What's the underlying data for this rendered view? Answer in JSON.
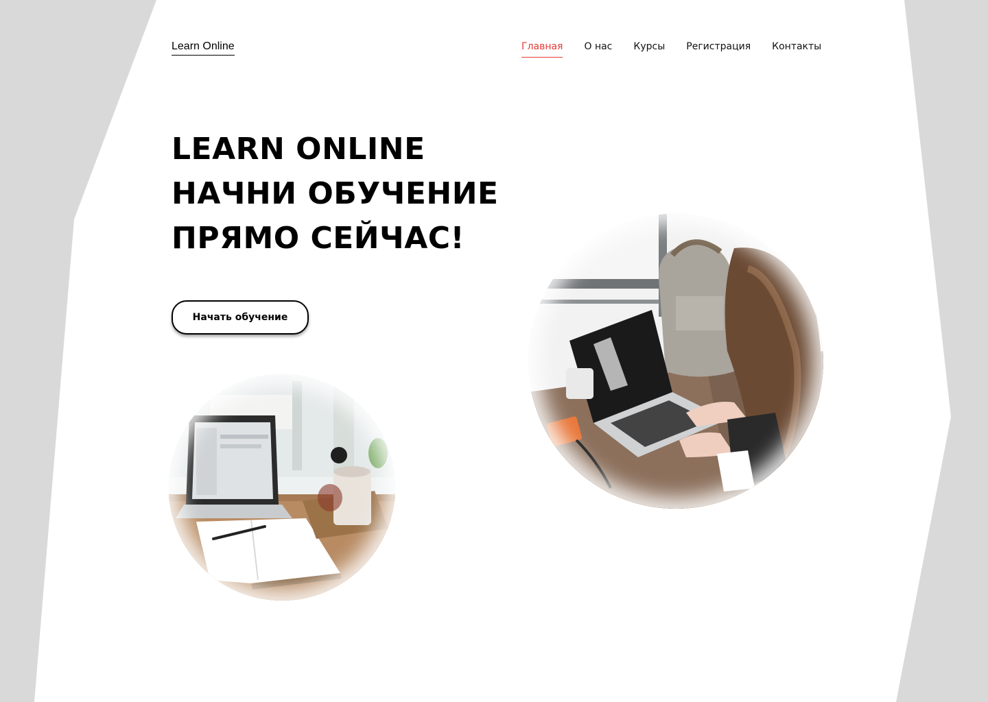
{
  "header": {
    "logo": "Learn Online",
    "nav": [
      {
        "label": "Главная",
        "active": true
      },
      {
        "label": "О нас",
        "active": false
      },
      {
        "label": "Курсы",
        "active": false
      },
      {
        "label": "Регистрация",
        "active": false
      },
      {
        "label": "Контакты",
        "active": false
      }
    ]
  },
  "hero": {
    "title_lines": [
      "LEARN ONLINE",
      "НАЧНИ ОБУЧЕНИЕ",
      "ПРЯМО СЕЙЧАС!"
    ],
    "cta_label": "Начать обучение"
  },
  "images": {
    "small": "laptop-notebook-photo",
    "large": "woman-laptop-photo"
  },
  "colors": {
    "accent": "#e53935",
    "background": "#d9d9d9",
    "panel": "#ffffff",
    "text": "#000000"
  }
}
